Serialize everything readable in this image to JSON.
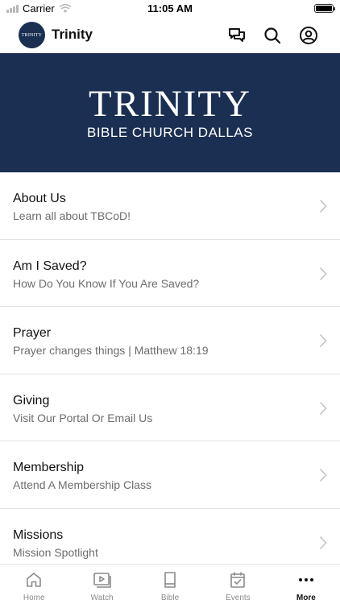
{
  "status_bar": {
    "carrier": "Carrier",
    "time": "11:05 AM"
  },
  "header": {
    "title": "Trinity",
    "avatar_text": "TRINITY",
    "icons": [
      "chat-icon",
      "search-icon",
      "account-icon"
    ]
  },
  "banner": {
    "title": "TRINITY",
    "subtitle": "BIBLE CHURCH DALLAS",
    "background_color": "#1b2f52"
  },
  "menu": {
    "items": [
      {
        "title": "About Us",
        "subtitle": "Learn all about TBCoD!"
      },
      {
        "title": "Am I Saved?",
        "subtitle": "How Do You Know If You Are Saved?"
      },
      {
        "title": "Prayer",
        "subtitle": "Prayer changes things | Matthew 18:19"
      },
      {
        "title": "Giving",
        "subtitle": "Visit Our Portal Or Email Us"
      },
      {
        "title": "Membership",
        "subtitle": "Attend A Membership Class"
      },
      {
        "title": "Missions",
        "subtitle": "Mission Spotlight"
      }
    ]
  },
  "tab_bar": {
    "tabs": [
      {
        "label": "Home",
        "icon": "home-icon"
      },
      {
        "label": "Watch",
        "icon": "watch-icon"
      },
      {
        "label": "Bible",
        "icon": "bible-icon"
      },
      {
        "label": "Events",
        "icon": "calendar-icon"
      },
      {
        "label": "More",
        "icon": "more-icon",
        "active": true
      }
    ]
  }
}
